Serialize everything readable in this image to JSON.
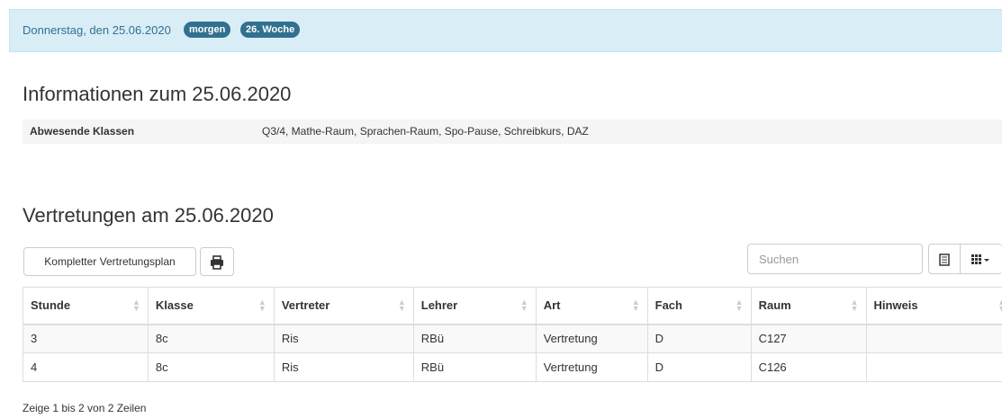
{
  "header": {
    "date": "Donnerstag, den 25.06.2020",
    "badge_day": "morgen",
    "badge_week": "26. Woche"
  },
  "info": {
    "title": "Informationen zum 25.06.2020",
    "absent_label": "Abwesende Klassen",
    "absent_value": "Q3/4, Mathe-Raum, Sprachen-Raum, Spo-Pause, Schreibkurs, DAZ"
  },
  "substitutions": {
    "title": "Vertretungen am 25.06.2020",
    "full_plan_label": "Kompletter Vertretungsplan",
    "search_placeholder": "Suchen",
    "columns": [
      "Stunde",
      "Klasse",
      "Vertreter",
      "Lehrer",
      "Art",
      "Fach",
      "Raum",
      "Hinweis"
    ],
    "rows": [
      [
        "3",
        "8c",
        "Ris",
        "RBü",
        "Vertretung",
        "D",
        "C127",
        ""
      ],
      [
        "4",
        "8c",
        "Ris",
        "RBü",
        "Vertretung",
        "D",
        "C126",
        ""
      ]
    ],
    "footer": "Zeige 1 bis 2 von 2 Zeilen"
  },
  "icons": {
    "print": "print-icon",
    "list_view": "list-view-icon",
    "columns": "columns-icon"
  },
  "colors": {
    "header_bg": "#d9edf7",
    "header_text": "#31708f",
    "badge_bg": "#31708f"
  }
}
